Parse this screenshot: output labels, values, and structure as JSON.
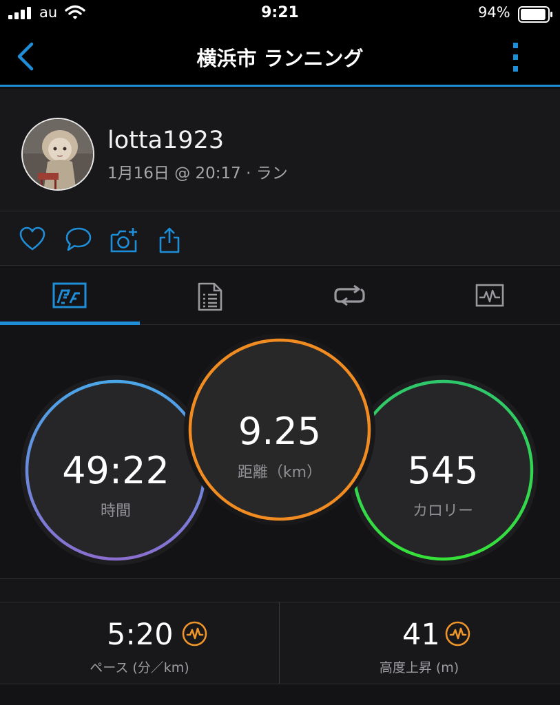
{
  "status_bar": {
    "carrier": "au",
    "time": "9:21",
    "battery_percent": "94%",
    "battery_level": 0.94
  },
  "nav": {
    "title": "横浜市 ランニング",
    "back_icon": "chevron-left-icon",
    "more_icon": "vertical-dots-icon"
  },
  "profile": {
    "username": "lotta1923",
    "meta": "1月16日 @ 20:17 · ラン"
  },
  "actions": [
    {
      "icon": "heart-icon"
    },
    {
      "icon": "comment-icon"
    },
    {
      "icon": "add-photo-icon"
    },
    {
      "icon": "share-icon"
    }
  ],
  "tabs": [
    {
      "icon": "overview-icon",
      "selected": true
    },
    {
      "icon": "details-icon",
      "selected": false
    },
    {
      "icon": "laps-icon",
      "selected": false
    },
    {
      "icon": "graph-icon",
      "selected": false
    }
  ],
  "stats": {
    "time": {
      "value": "49:22",
      "label": "時間"
    },
    "distance": {
      "value": "9.25",
      "label": "距離（km）"
    },
    "calories": {
      "value": "545",
      "label": "カロリー"
    }
  },
  "metrics": {
    "pace": {
      "value": "5:20",
      "label": "ペース (分／km)",
      "icon": "insight-icon"
    },
    "elevation": {
      "value": "41",
      "label": "高度上昇 (m)",
      "icon": "insight-icon"
    }
  },
  "colors": {
    "accent": "#1f8ed8",
    "time_ring": [
      "#4aa6e8",
      "#8a6fd0"
    ],
    "distance_ring": "#f08c21",
    "calories_ring": [
      "#2fc76c",
      "#36e13a"
    ],
    "insight_icon": "#f0952a"
  }
}
